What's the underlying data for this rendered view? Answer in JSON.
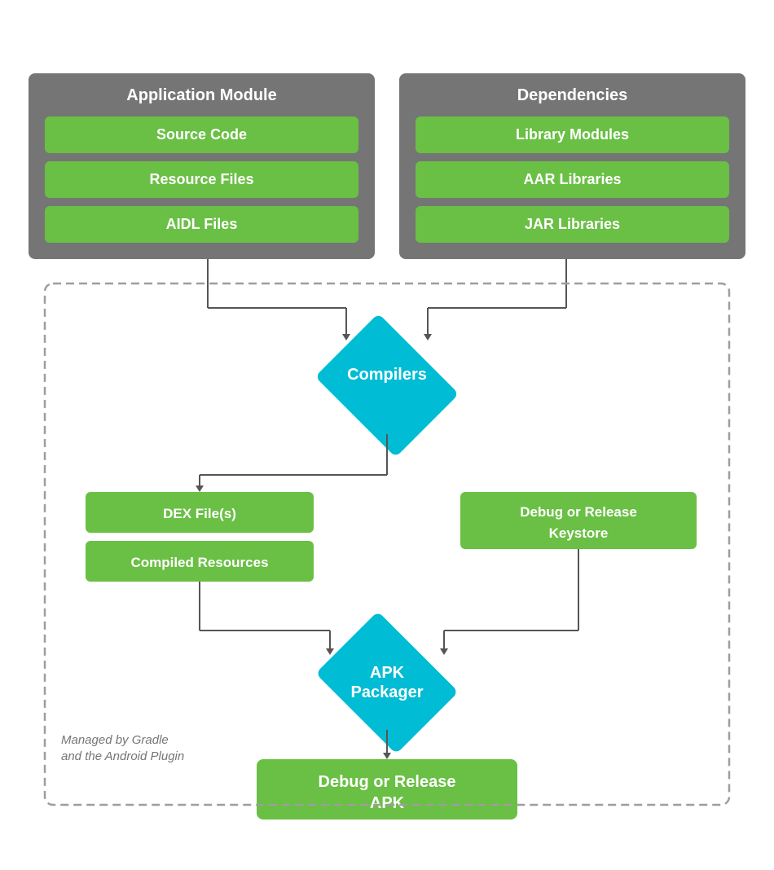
{
  "app_module": {
    "title": "Application Module",
    "items": [
      "Source Code",
      "Resource Files",
      "AIDL Files"
    ]
  },
  "dependencies": {
    "title": "Dependencies",
    "items": [
      "Library Modules",
      "AAR Libraries",
      "JAR Libraries"
    ]
  },
  "compilers": {
    "label": "Compilers"
  },
  "dex_files": {
    "label": "DEX File(s)"
  },
  "compiled_resources": {
    "label": "Compiled Resources"
  },
  "keystore": {
    "label": "Debug or Release\nKeystore"
  },
  "apk_packager": {
    "label": "APK\nPackager"
  },
  "output": {
    "label": "Debug or Release\nAPK"
  },
  "gradle_label": {
    "line1": "Managed by Gradle",
    "line2": "and the Android Plugin"
  }
}
